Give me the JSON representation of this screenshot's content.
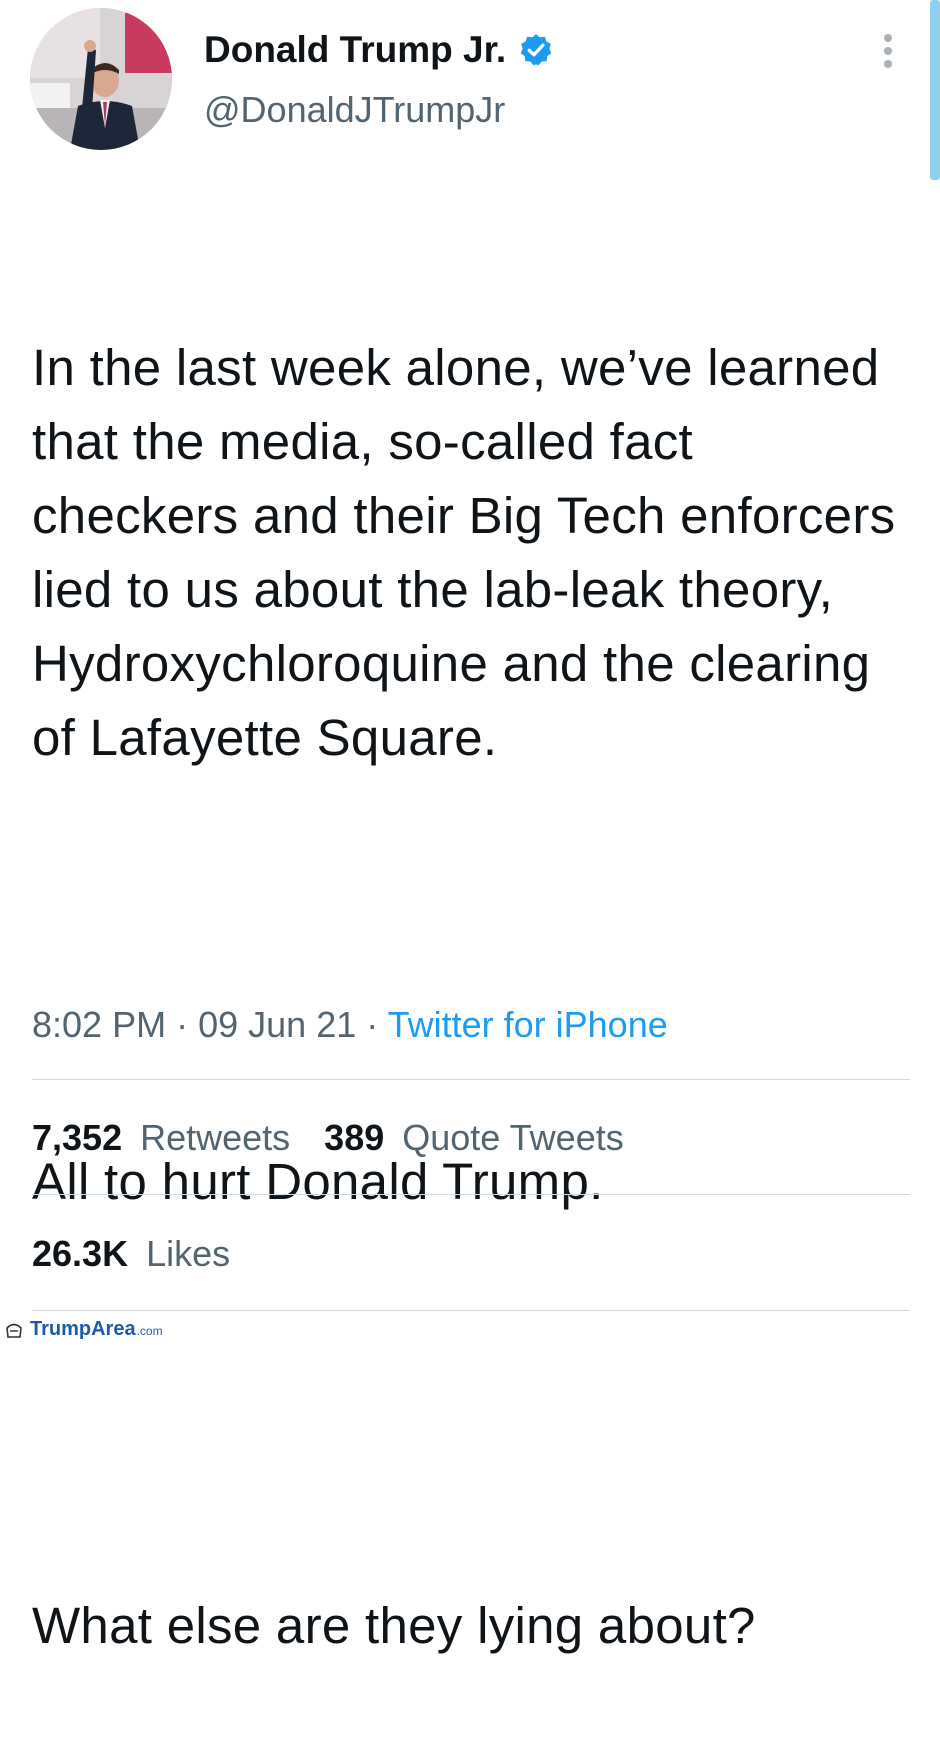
{
  "author": {
    "display_name": "Donald Trump Jr.",
    "handle": "@DonaldJTrumpJr",
    "verified": true,
    "avatar": "profile-photo"
  },
  "tweet": {
    "paragraphs": [
      "In the last week alone, we’ve learned that the media, so-called fact checkers and their Big Tech enforcers lied to us about the lab-leak theory, Hydroxychloroquine and the clearing of Lafayette Square.",
      "All to hurt Donald Trump.",
      "What else are they lying about?"
    ]
  },
  "meta": {
    "time": "8:02 PM",
    "separator": "·",
    "date": "09 Jun 21",
    "source": "Twitter for iPhone"
  },
  "stats": {
    "retweets_count": "7,352",
    "retweets_label": "Retweets",
    "quotes_count": "389",
    "quotes_label": "Quote Tweets",
    "likes_count": "26.3K",
    "likes_label": "Likes"
  },
  "watermark": {
    "text": "TrumpArea",
    "tld": ".com"
  },
  "colors": {
    "verified": "#1d9bf0",
    "link": "#1d9bf0",
    "muted": "#536471",
    "text": "#0f1419",
    "divider": "#cfd9de"
  }
}
